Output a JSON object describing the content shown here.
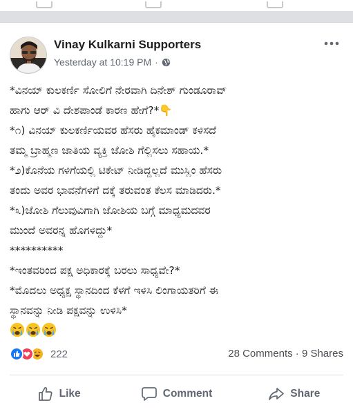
{
  "post": {
    "page_name": "Vinay Kulkarni Supporters",
    "timestamp": "Yesterday at 10:19 PM",
    "separator": "·",
    "privacy_icon": "globe-icon",
    "more_icon": "more-options-icon",
    "body_lines": [
      "*ವಿನಯ್ ಕುಲಕರ್ಣಿ ಸೋಲಿಗೆ ನೇರವಾಗಿ ದಿನೇಶ್ ಗುಂಡೂರಾವ್",
      "ಹಾಗು ಆರ್ ವಿ ದೇಶಪಾಂಡೆ ಕಾರಣ  ಹೇಗೆ?*👇",
      "*೧) ವಿನಯ್ ಕುಲಕರ್ಣಿಯವರ ಹೆಸರು ಹೈಕಮಾಂಡ್ ಕಳಿಸದೆ",
      "ತಮ್ಮ ಬ್ರಾಹ್ಮಣ ಜಾತಿಯ ವ್ಯಕ್ತಿ ಜೋಶಿ ಗೆಲ್ಲಿಸಲು ಸಹಾಯ.*",
      "*೨)ಕೊನೆಯ ಗಳಿಗೆಯಲ್ಲಿ ಟಿಕೇಟ್ ನೀಡಿದ್ದಲ್ಲದೆ ಮುಸ್ಲಿಂ ಹೆಸರು",
      "ತಂದು ಅವರ ಭಾವನೆಗಳಿಗೆ ದಕ್ಕೆ ತರುವಂತ ಕೆಲಸ ಮಾಡಿದರು.*",
      "*೩)ಜೋಶಿ ಗೆಲುವುವಿಗಾಗಿ ಜೋಶಿಯ ಬಗ್ಗೆ ಮಾಧ್ಯಮದವರ",
      "ಮುಂದೆ ಅವರನ್ನ ಹೊಗಳಿದ್ದು*",
      "**********",
      "*ಇಂತವರಿಂದ ಪಕ್ಷ ಅಧಿಕಾರಕ್ಕೆ ಬರಲು ಸಾಧ್ಯವೇ?*",
      "*ಮೊದಲು ಅಧ್ಯಕ್ಷ ಸ್ಥಾನದಿಂದ ಕೆಳಗೆ ಇಳಿಸಿ  ಲಿಂಗಾಯತರಿಗೆ ಈ",
      "ಸ್ಥಾನವನ್ನು ನೀಡಿ ಪಕ್ಷವನ್ನು ಉಳಿಸಿ*"
    ],
    "emoji_line": [
      "crying-face",
      "crying-face",
      "crying-face"
    ],
    "reactions": {
      "icons": [
        "like-reaction-icon",
        "love-reaction-icon",
        "haha-reaction-icon"
      ],
      "count": "222"
    },
    "comments_shares": "28 Comments · 9 Shares",
    "actions": {
      "like": "Like",
      "comment": "Comment",
      "share": "Share"
    }
  },
  "colors": {
    "page_background": "#dddfe2",
    "card_background": "#ffffff",
    "primary_text": "#1c1e21",
    "secondary_text": "#606770",
    "like_blue": "#1877f2",
    "love_red": "#f33e58",
    "haha_yellow": "#f7b125"
  }
}
